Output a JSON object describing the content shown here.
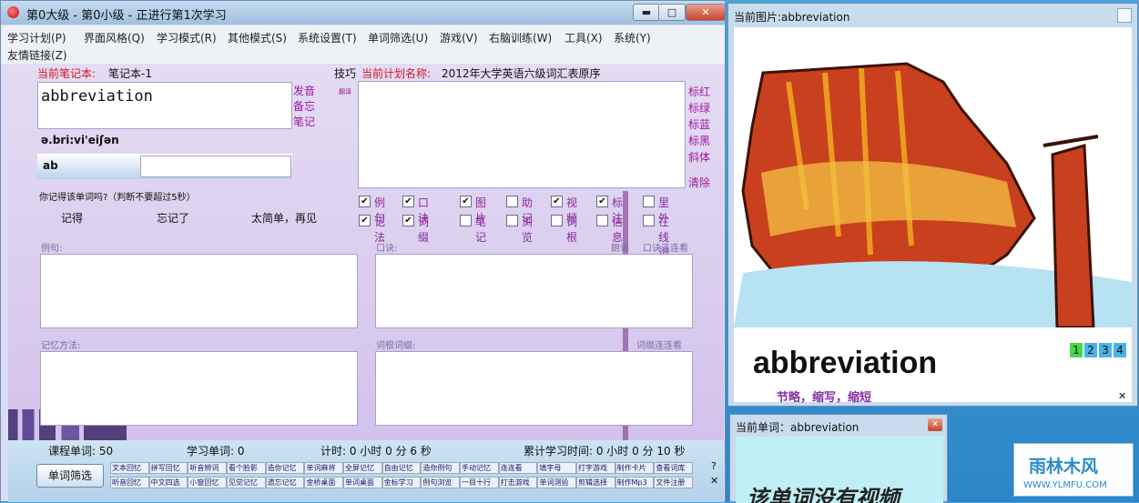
{
  "main_window": {
    "title": "第0大级 - 第0小级 - 正进行第1次学习",
    "controls": {
      "minimize": "▬",
      "maximize": "□",
      "close": "✕"
    }
  },
  "menu": [
    {
      "label": "学习计划(P)"
    },
    {
      "label": "界面风格(Q)"
    },
    {
      "label": "学习模式(R)"
    },
    {
      "label": "其他模式(S)"
    },
    {
      "label": "系统设置(T)"
    },
    {
      "label": "单词筛选(U)"
    },
    {
      "label": "游戏(V)"
    },
    {
      "label": "右脑训练(W)"
    },
    {
      "label": "工具(X)"
    },
    {
      "label": "系统(Y)"
    },
    {
      "label": "友情链接(Z)"
    }
  ],
  "notebook": {
    "label": "当前笔记本:",
    "value": "笔记本-1"
  },
  "plan": {
    "tips": "技巧",
    "label": "当前计划名称:",
    "value": "2012年大学英语六级词汇表原序"
  },
  "word": {
    "text": "abbreviation",
    "phonetic": "ə.bri:vi'eiʃən",
    "input_prefix": "ab",
    "side_links": [
      "发音",
      "备忘",
      "笔记"
    ],
    "small_tag": "翻译"
  },
  "right_links": [
    "标红",
    "标绿",
    "标蓝",
    "标黑",
    "斜体",
    "清除"
  ],
  "recall": {
    "question": "你记得该单词吗?（判断不要超过5秒）",
    "remember": "记得",
    "forgot": "忘记了",
    "too_easy": "太简单，再见"
  },
  "checkboxes_row1": [
    {
      "label": "例句",
      "checked": true
    },
    {
      "label": "口诀",
      "checked": true
    },
    {
      "label": "图片",
      "checked": true
    },
    {
      "label": "助记",
      "checked": false
    },
    {
      "label": "视频",
      "checked": true
    },
    {
      "label": "标注",
      "checked": true
    },
    {
      "label": "里外",
      "checked": false
    }
  ],
  "checkboxes_row2": [
    {
      "label": "记法",
      "checked": true
    },
    {
      "label": "词缀",
      "checked": true
    },
    {
      "label": "笔记",
      "checked": false
    },
    {
      "label": "浏览",
      "checked": false
    },
    {
      "label": "词根",
      "checked": false
    },
    {
      "label": "信息",
      "checked": false
    },
    {
      "label": "在线词典",
      "checked": false
    }
  ],
  "panels": {
    "example": "例句:",
    "mnemonic": "口诀:",
    "read": "朗读",
    "mnemonic_link": "口诀连连看",
    "memory": "记忆方法:",
    "root": "词根词缀:",
    "root_link": "词缀连连看"
  },
  "status": {
    "course_words": "课程单词: 50",
    "study_words": "学习单词: 0",
    "timer": "计时: 0 小时 0 分 6 秒",
    "total_time": "累计学习时间: 0 小时 0 分 10 秒"
  },
  "filter_button": "单词筛选",
  "mini_buttons_row1": [
    "文本回忆",
    "拼写回忆",
    "听音辨词",
    "看个脸影",
    "造你记忆",
    "单词麻将",
    "全屏记忆",
    "自由记忆",
    "造你例句",
    "手动记忆",
    "连连看",
    "填字母",
    "打字游戏",
    "制作卡片",
    "查看词库"
  ],
  "mini_buttons_row2": [
    "听音回忆",
    "中文四选",
    "小窗回忆",
    "见觉记忆",
    "遗忘记忆",
    "金桥桌面",
    "单词桌面",
    "金标学习",
    "例句浏览",
    "一目十行",
    "打击游戏",
    "单词测验",
    "剪辑选择",
    "制作Mp3",
    "文件注册"
  ],
  "picture_window": {
    "title": "当前图片:abbreviation",
    "caption_word": "abbreviation",
    "caption_cn": "节略，缩写，缩短",
    "pages": [
      "1",
      "2",
      "3",
      "4"
    ],
    "close": "✕"
  },
  "word_window": {
    "title": "当前单词：abbreviation",
    "close": "✕",
    "message": "该单词没有视频"
  },
  "logo": {
    "name": "雨林木风",
    "url": "WWW.YLMFU.COM"
  }
}
